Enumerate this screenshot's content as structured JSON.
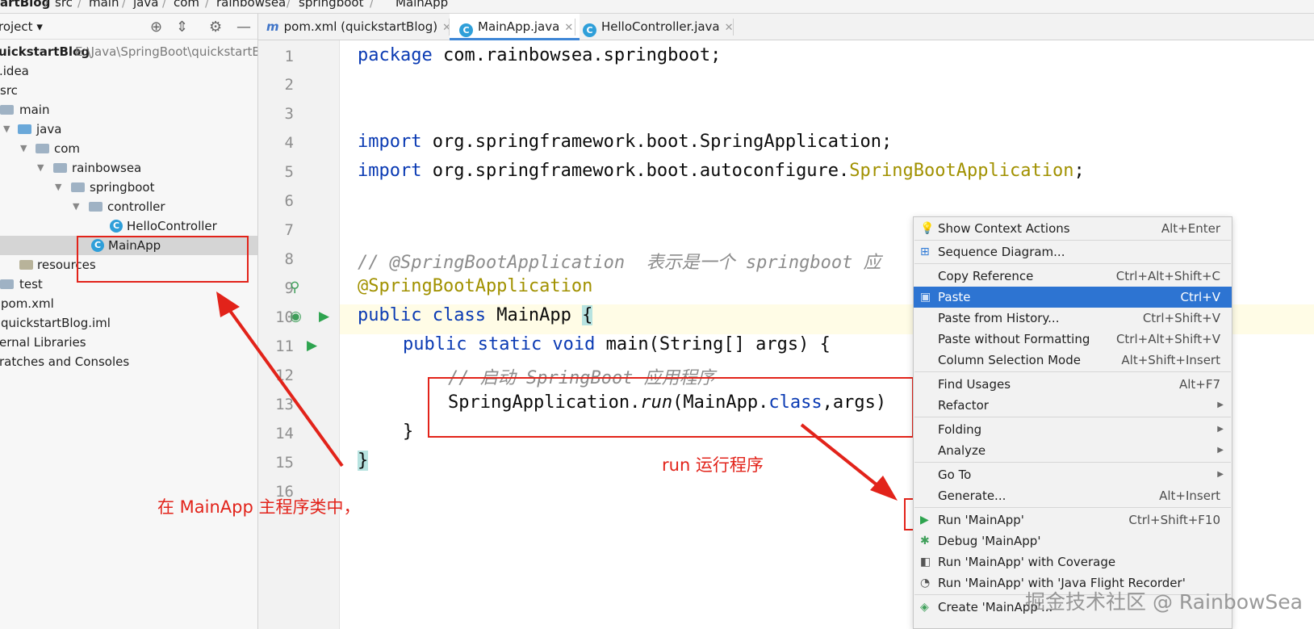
{
  "breadcrumb": [
    "artBlog",
    "src",
    "main",
    "java",
    "com",
    "rainbowsea",
    "springboot",
    "MainApp"
  ],
  "project_panel": {
    "title": "roject",
    "tree": [
      {
        "label": "uickstartBlog",
        "hint": "E:\\Java\\SpringBoot\\quickstartB"
      },
      {
        "label": ".idea"
      },
      {
        "label": "src"
      },
      {
        "label": "main"
      },
      {
        "label": "java"
      },
      {
        "label": "com"
      },
      {
        "label": "rainbowsea"
      },
      {
        "label": "springboot"
      },
      {
        "label": "controller"
      },
      {
        "label": "HelloController"
      },
      {
        "label": "MainApp"
      },
      {
        "label": "resources"
      },
      {
        "label": "test"
      },
      {
        "label": "pom.xml"
      },
      {
        "label": "quickstartBlog.iml"
      },
      {
        "label": "ernal Libraries"
      },
      {
        "label": "ratches and Consoles"
      }
    ]
  },
  "tabs": [
    {
      "label": "pom.xml (quickstartBlog)",
      "icon": "maven-icon"
    },
    {
      "label": "MainApp.java",
      "icon": "class-icon",
      "active": true
    },
    {
      "label": "HelloController.java",
      "icon": "class-icon"
    }
  ],
  "editor": {
    "line_numbers": [
      "1",
      "2",
      "3",
      "4",
      "5",
      "6",
      "7",
      "8",
      "9",
      "10",
      "11",
      "12",
      "13",
      "14",
      "15",
      "16"
    ],
    "code": {
      "l1_kw": "package",
      "l1_rest": " com.rainbowsea.springboot;",
      "l4_kw": "import",
      "l4_rest": " org.springframework.boot.SpringApplication;",
      "l5_kw": "import",
      "l5_rest": " org.springframework.boot.autoconfigure.",
      "l5_ann": "SpringBootApplication",
      "l5_end": ";",
      "l8_comment": "// @SpringBootApplication  表示是一个 springboot 应",
      "l9_ann": "@SpringBootApplication",
      "l10_kw": "public class",
      "l10_rest": " MainApp ",
      "l10_brace": "{",
      "l11_kw": "public static void",
      "l11_rest": " main(String[] args) {",
      "l12_comment": "// 启动 SpringBoot 应用程序",
      "l13_a": "SpringApplication.",
      "l13_run": "run",
      "l13_b": "(MainApp.",
      "l13_kw": "class",
      "l13_c": ",args)",
      "l14": "}",
      "l15": "}"
    }
  },
  "annotations": {
    "left_note": "在 MainApp 主程序类中，",
    "run_note": "run 运行程序"
  },
  "context_menu": [
    {
      "label": "Show Context Actions",
      "shortcut": "Alt+Enter",
      "icon": "bulb-icon"
    },
    {
      "label": "Sequence Diagram...",
      "shortcut": "",
      "icon": "sequence-icon"
    },
    {
      "label": "Copy Reference",
      "shortcut": "Ctrl+Alt+Shift+C"
    },
    {
      "label": "Paste",
      "shortcut": "Ctrl+V",
      "icon": "paste-icon",
      "highlighted": true
    },
    {
      "label": "Paste from History...",
      "shortcut": "Ctrl+Shift+V"
    },
    {
      "label": "Paste without Formatting",
      "shortcut": "Ctrl+Alt+Shift+V"
    },
    {
      "label": "Column Selection Mode",
      "shortcut": "Alt+Shift+Insert"
    },
    {
      "label": "Find Usages",
      "shortcut": "Alt+F7"
    },
    {
      "label": "Refactor",
      "shortcut": "",
      "submenu": true
    },
    {
      "label": "Folding",
      "shortcut": "",
      "submenu": true
    },
    {
      "label": "Analyze",
      "shortcut": "",
      "submenu": true
    },
    {
      "label": "Go To",
      "shortcut": "",
      "submenu": true
    },
    {
      "label": "Generate...",
      "shortcut": "Alt+Insert"
    },
    {
      "label": "Run 'MainApp'",
      "shortcut": "Ctrl+Shift+F10",
      "icon": "run-icon"
    },
    {
      "label": "Debug 'MainApp'",
      "shortcut": "",
      "icon": "debug-icon"
    },
    {
      "label": "Run 'MainApp' with Coverage",
      "shortcut": "",
      "icon": "coverage-icon"
    },
    {
      "label": "Run 'MainApp' with 'Java Flight Recorder'",
      "shortcut": "",
      "icon": "profiler-icon"
    },
    {
      "label": "Create 'MainApp'...",
      "shortcut": "",
      "icon": "config-icon"
    }
  ],
  "watermark": "掘金技术社区 @ RainbowSea",
  "colors": {
    "accent": "#2d74d2",
    "annotation_red": "#e2231a",
    "keyword": "#0a3ab3",
    "annotation_code": "#a19100"
  }
}
